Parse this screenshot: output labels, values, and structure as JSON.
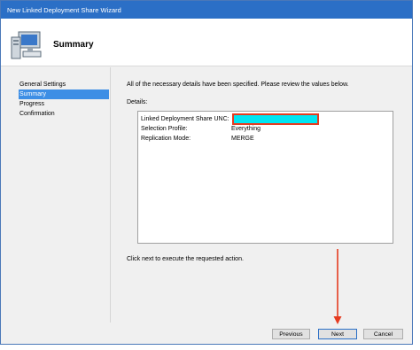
{
  "window": {
    "title": "New Linked Deployment Share Wizard"
  },
  "header": {
    "title": "Summary",
    "icon": "computer-icon"
  },
  "steps": [
    {
      "label": "General Settings",
      "active": false
    },
    {
      "label": "Summary",
      "active": true
    },
    {
      "label": "Progress",
      "active": false
    },
    {
      "label": "Confirmation",
      "active": false
    }
  ],
  "summary": {
    "intro": "All of the necessary details have been specified.  Please review the values below.",
    "details_label": "Details:",
    "rows": [
      {
        "key": "Linked Deployment Share UNC:",
        "value": ""
      },
      {
        "key": "Selection Profile:",
        "value": "Everything"
      },
      {
        "key": "Replication Mode:",
        "value": "MERGE"
      }
    ],
    "footer_text": "Click next to execute the requested action."
  },
  "buttons": {
    "previous": "Previous",
    "next": "Next",
    "cancel": "Cancel"
  },
  "colors": {
    "titlebar": "#2b6fc6",
    "active_step": "#3d8ee5",
    "redaction": "#00e5f2",
    "annotation": "#e53b20"
  }
}
